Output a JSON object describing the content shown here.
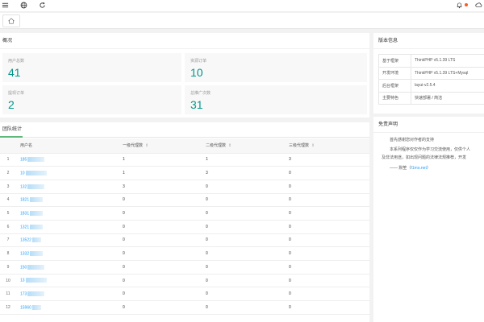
{
  "topbar": {
    "menu_icon": "menu-icon",
    "web_icon": "globe-icon",
    "refresh_icon": "refresh-icon",
    "notice_icon": "bell-icon",
    "theme_icon": "theme-icon",
    "badge_color": "#ff5722"
  },
  "tabbar": {
    "home_icon": "home-icon"
  },
  "overview": {
    "title": "概况",
    "stats": [
      {
        "label": "用户总数",
        "value": "41"
      },
      {
        "label": "资源订单",
        "value": "10"
      },
      {
        "label": "提现订单",
        "value": "2"
      },
      {
        "label": "总推广次数",
        "value": "31"
      }
    ]
  },
  "team": {
    "tab_label": "团队统计",
    "columns": [
      "",
      "用户名",
      "一级代理数",
      "二级代理数",
      "三级代理数"
    ],
    "rows": [
      {
        "idx": "1",
        "name": "185",
        "l1": "1",
        "l2": "1",
        "l3": "3"
      },
      {
        "idx": "2",
        "name": "10",
        "l1": "1",
        "l2": "3",
        "l3": "0"
      },
      {
        "idx": "3",
        "name": "132",
        "l1": "3",
        "l2": "0",
        "l3": "0"
      },
      {
        "idx": "4",
        "name": "1821",
        "l1": "0",
        "l2": "0",
        "l3": "0"
      },
      {
        "idx": "5",
        "name": "1831",
        "l1": "0",
        "l2": "0",
        "l3": "0"
      },
      {
        "idx": "6",
        "name": "1321",
        "l1": "0",
        "l2": "0",
        "l3": "0"
      },
      {
        "idx": "7",
        "name": "13522",
        "l1": "0",
        "l2": "0",
        "l3": "0"
      },
      {
        "idx": "8",
        "name": "1332",
        "l1": "0",
        "l2": "0",
        "l3": "0"
      },
      {
        "idx": "9",
        "name": "150",
        "l1": "0",
        "l2": "0",
        "l3": "0"
      },
      {
        "idx": "10",
        "name": "13",
        "l1": "0",
        "l2": "0",
        "l3": "0"
      },
      {
        "idx": "11",
        "name": "173",
        "l1": "0",
        "l2": "0",
        "l3": "0"
      },
      {
        "idx": "12",
        "name": "15960",
        "l1": "0",
        "l2": "0",
        "l3": "0"
      }
    ]
  },
  "version": {
    "title": "版本信息",
    "rows": [
      {
        "k": "基于框架",
        "v": "ThinkPHP v5.1.39 LTS"
      },
      {
        "k": "开发环境",
        "v": "ThinkPHP v5.1.39 LTS+Mysql"
      },
      {
        "k": "后台框架",
        "v": "layui-v2.5.4"
      },
      {
        "k": "主要特色",
        "v": "快速部署 / 简洁"
      }
    ]
  },
  "disclaimer": {
    "title": "免责声明",
    "line1": "首先感谢您对作者的支持",
    "line2": "本系列程序仅仅作为学习交流使用，仅供个人",
    "line3": "及非法用途，如出现问题的法律法规推荐，开发",
    "sign_prefix": "—— 默笙（",
    "sign_link": "f1mo.net",
    "sign_suffix": "）"
  }
}
